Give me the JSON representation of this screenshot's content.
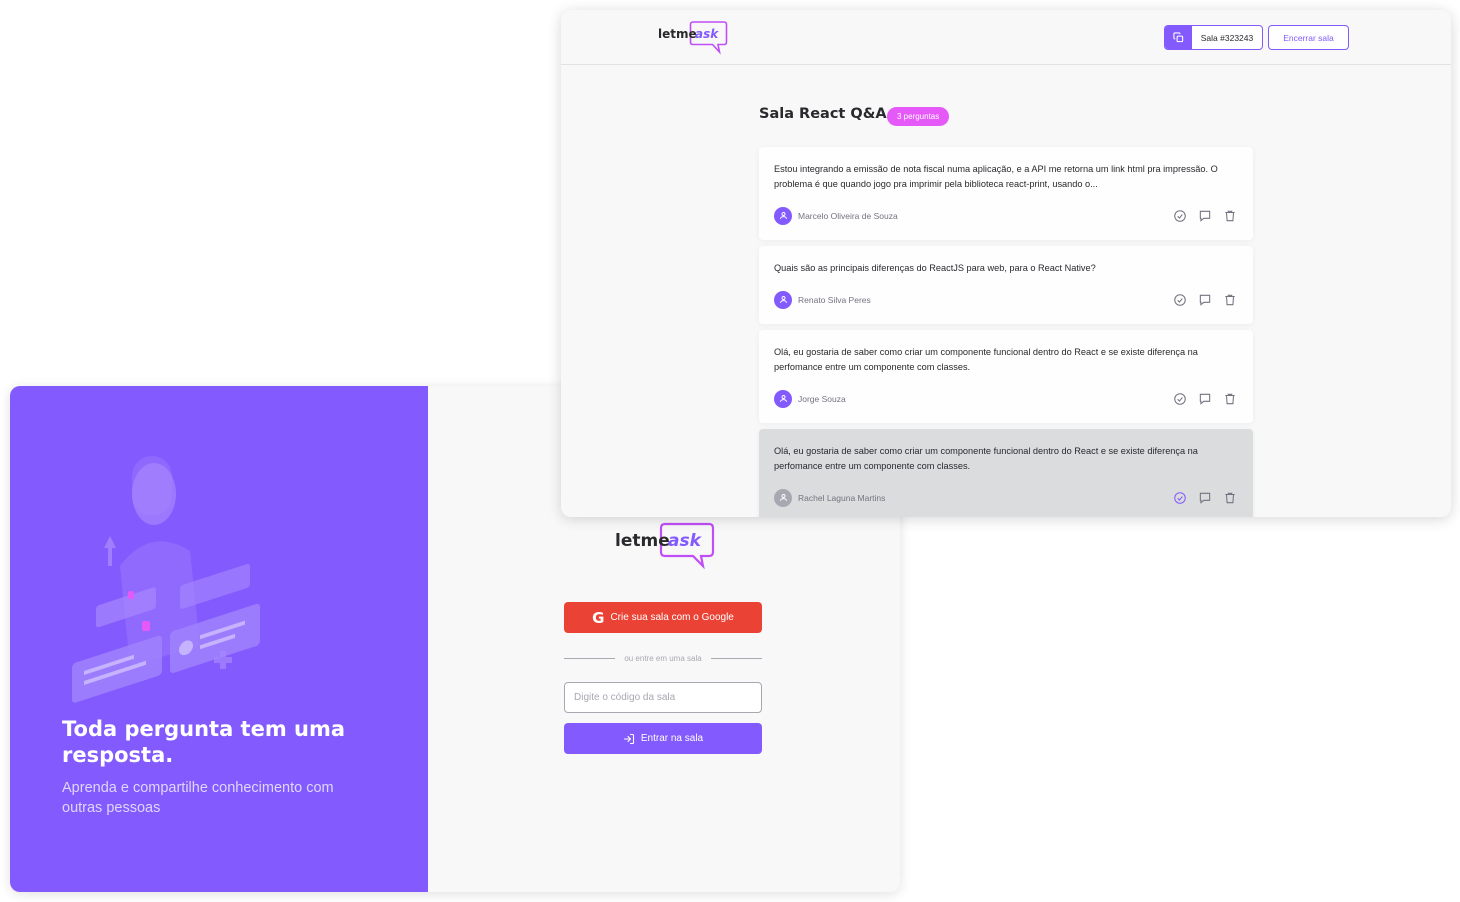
{
  "colors": {
    "brand": "#835afd",
    "pink": "#e559f9",
    "google": "#ea4335",
    "text": "#29292e",
    "muted": "#737380"
  },
  "logo": {
    "part1": "letme",
    "part2": "ask"
  },
  "login": {
    "aside_title": "Toda pergunta tem uma resposta.",
    "aside_subtitle": "Aprenda e compartilhe conhecimento com outras pessoas",
    "google_button": "Crie sua sala com o Google",
    "separator": "ou entre em uma sala",
    "room_input_placeholder": "Digite o código da sala",
    "enter_button": "Entrar na sala"
  },
  "room": {
    "room_code": "Sala #323243",
    "close_button": "Encerrar sala",
    "title": "Sala React Q&A",
    "badge": "3 perguntas",
    "questions": [
      {
        "text": "Estou integrando a emissão de nota fiscal numa aplicação, e a API me retorna um link html pra impressão. O problema é que quando jogo pra imprimir pela biblioteca react-print, usando o...",
        "author": "Marcelo Oliveira de Souza"
      },
      {
        "text": "Quais são as principais diferenças do ReactJS para web, para o React Native?",
        "author": "Renato Silva Peres"
      },
      {
        "text": "Olá, eu gostaria de saber como criar um componente funcional dentro do React e se existe diferença na perfomance entre um componente com classes.",
        "author": "Jorge Souza"
      },
      {
        "text": "Olá, eu gostaria de saber como criar um componente funcional dentro do React e se existe diferença na perfomance entre um componente com classes.",
        "author": "Rachel Laguna Martins"
      }
    ]
  }
}
